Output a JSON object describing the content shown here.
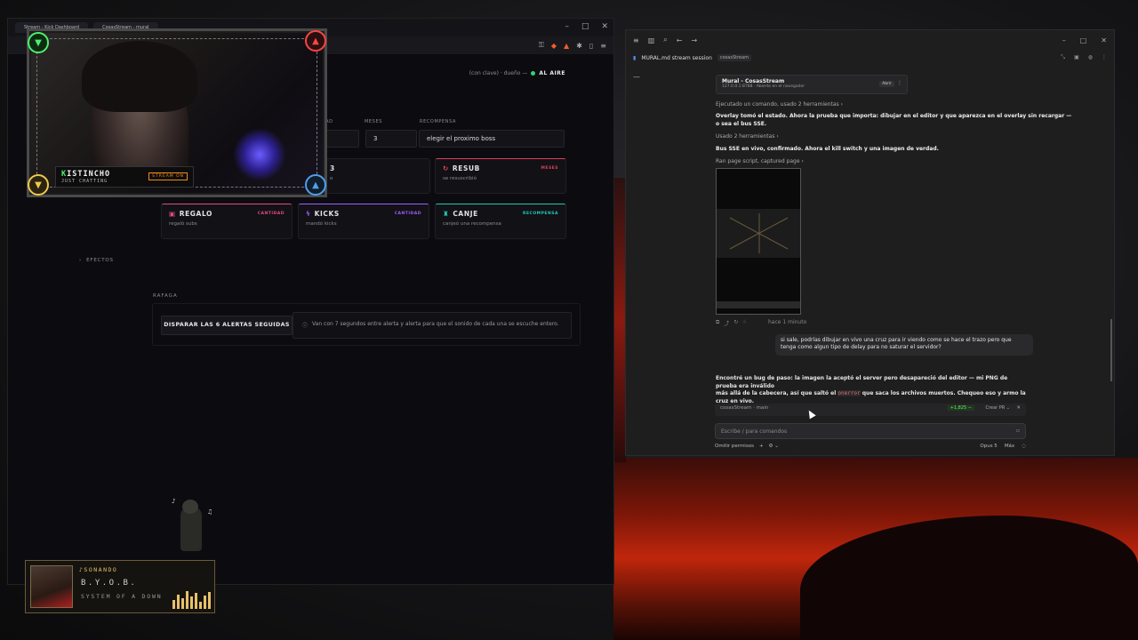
{
  "browser": {
    "tabs": [
      "Stream - Kick Dashboard",
      "CosasStream - mural"
    ],
    "status": {
      "left": "(con clave) · dueño —",
      "live": "AL AIRE"
    },
    "headers": {
      "meses": "MESES",
      "recompensa": "RECOMPENSA",
      "ad_fragment": "IAD"
    },
    "fields": {
      "months": "3",
      "reward": "elegir el proximo boss",
      "partial": "3"
    },
    "cards": [
      {
        "title": "RESUB",
        "badge": "MESES",
        "sub": "se resuscribió",
        "color": "#e0405a"
      },
      {
        "title": "REGALO",
        "badge": "CANTIDAD",
        "sub": "regaló subs",
        "color": "#e14a8a"
      },
      {
        "title": "KICKS",
        "badge": "CANTIDAD",
        "sub": "mandó kicks",
        "color": "#a25cff"
      },
      {
        "title": "CANJE",
        "badge": "RECOMPENSA",
        "sub": "canjeó una recompensa",
        "color": "#1fcab8"
      }
    ],
    "partial_sub": "o",
    "sidebar_item": "EFECTOS",
    "section": "RAFAGA",
    "fire_button": "DISPARAR LAS 6 ALERTAS SEGUIDAS",
    "info": "Van con 7 segundos entre alerta y alerta para que el sonido de cada una se escuche entero."
  },
  "webcam": {
    "name_prefix": "K",
    "name_rest": "ISTINCHO",
    "game": "JUST CHATTING",
    "live_badge": "STREAM ON"
  },
  "claude": {
    "title": "MURAL.md stream session",
    "tag": "cosasStream",
    "card": {
      "title": "Mural - CosasStream",
      "sub": "127.0.0.1:8788 · Abierto en el navegador",
      "button": "Abrir"
    },
    "lines": [
      "Ejecutado un comando, usado 2 herramientas",
      "Overlay tomó el estado. Ahora la prueba que importa: dibujar en el editor y que aparezca en el overlay sin recargar —",
      "o sea el bus SSE.",
      "Usado 2 herramientas",
      "Bus SSE en vivo, confirmado. Ahora el kill switch y una imagen de verdad.",
      "Ran page script, captured page"
    ],
    "time_ago": "hace 1 minuto",
    "user_msg": "si sale, podrías dibujar en vivo una cruz para ir viendo como se hace el trazo pero que tenga como algun tipo de delay para no saturar el servidor?",
    "reply_1": "Encontré un bug de paso: la imagen la aceptó el server pero desapareció del editor — mi PNG de prueba era inválido",
    "reply_2_pre": "más allá de la cabecera, así que saltó el",
    "reply_code": "onerror",
    "reply_2_post": "que saca los archivos muertos. Chequeo eso y armo la cruz en vivo.",
    "branch": "cosasStream · main",
    "diff": "+1,825 −",
    "pr": "Crear PR",
    "placeholder": "Escribe / para comandos",
    "footer_left": "Omitir permisos",
    "model": "Opus 5",
    "effort": "Máx"
  },
  "now_playing": {
    "label": "♪SONANDO",
    "song": "B.Y.O.B.",
    "artist": "SYSTEM OF A DOWN",
    "eq_levels": [
      0.5,
      0.8,
      0.6,
      1.0,
      0.7,
      0.9,
      0.4,
      0.75,
      0.95
    ]
  }
}
